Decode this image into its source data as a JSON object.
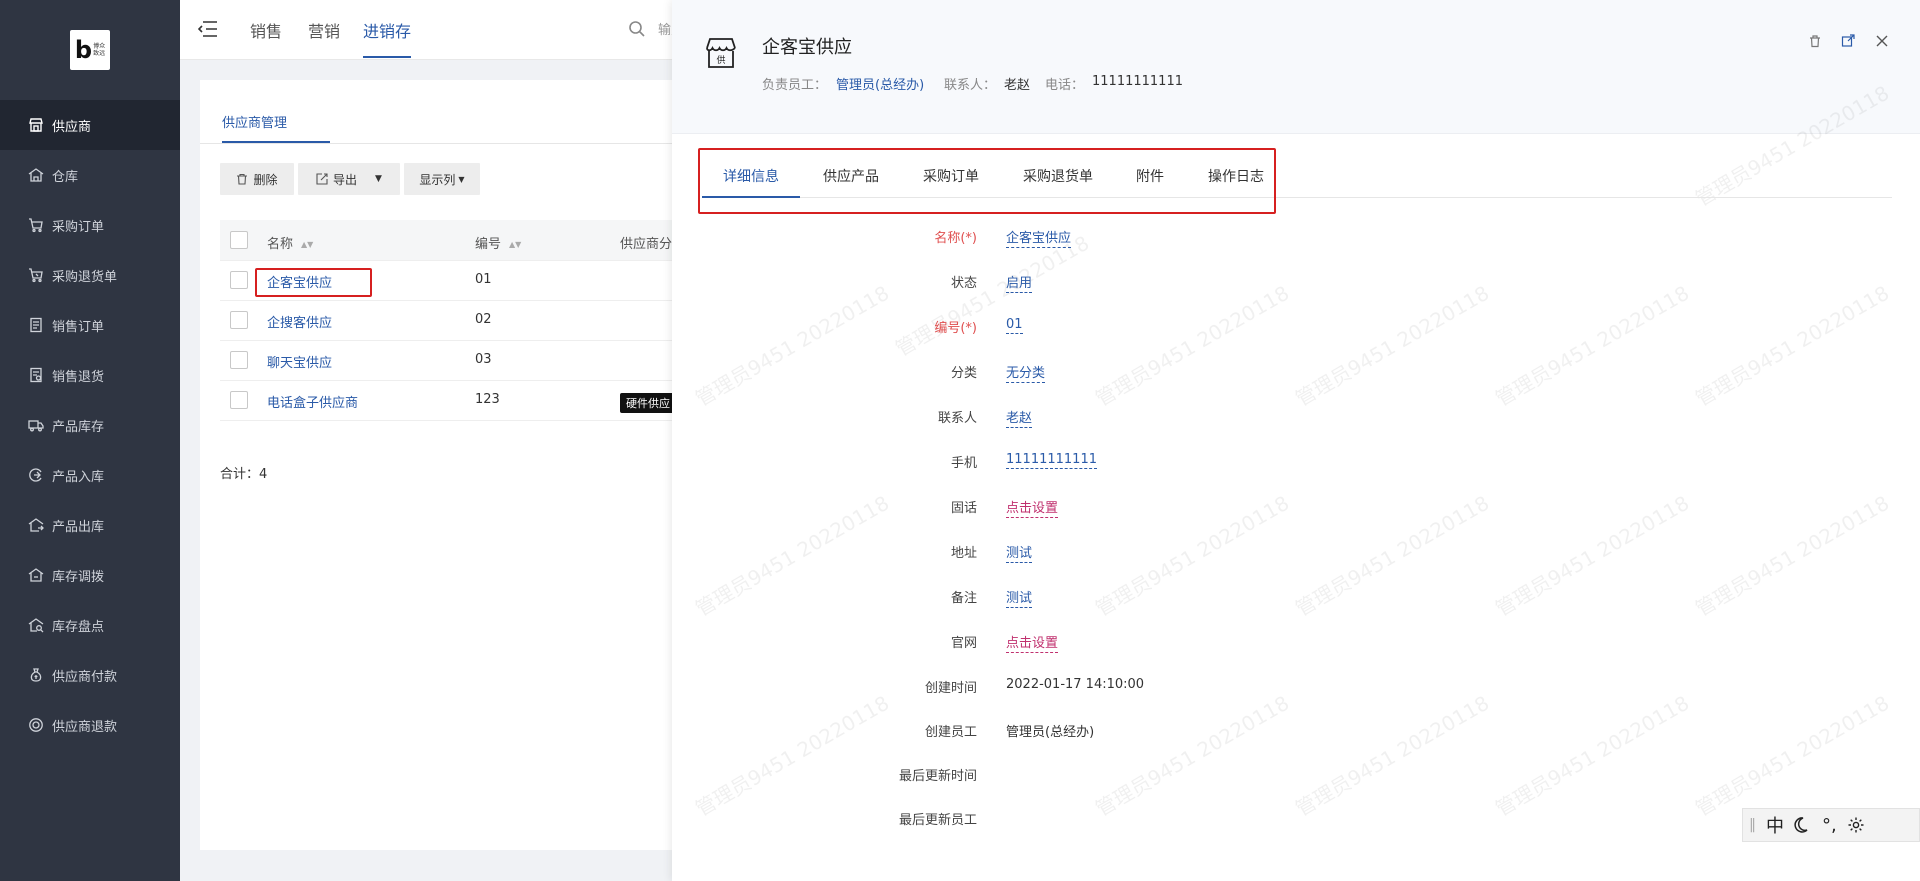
{
  "logo": {
    "mark": "b",
    "text_line1": "博众",
    "text_line2": "致远"
  },
  "sidebar": {
    "items": [
      {
        "label": "供应商",
        "icon": "store-icon"
      },
      {
        "label": "仓库",
        "icon": "warehouse-icon"
      },
      {
        "label": "采购订单",
        "icon": "cart-icon"
      },
      {
        "label": "采购退货单",
        "icon": "cart-return-icon"
      },
      {
        "label": "销售订单",
        "icon": "document-icon"
      },
      {
        "label": "销售退货",
        "icon": "document-return-icon"
      },
      {
        "label": "产品库存",
        "icon": "truck-icon"
      },
      {
        "label": "产品入库",
        "icon": "inbound-icon"
      },
      {
        "label": "产品出库",
        "icon": "outbound-icon"
      },
      {
        "label": "库存调拨",
        "icon": "transfer-icon"
      },
      {
        "label": "库存盘点",
        "icon": "inventory-check-icon"
      },
      {
        "label": "供应商付款",
        "icon": "money-bag-icon"
      },
      {
        "label": "供应商退款",
        "icon": "refund-icon"
      }
    ],
    "active_index": 0
  },
  "topbar": {
    "tabs": [
      "销售",
      "营销",
      "进销存"
    ],
    "active_tab": "进销存",
    "search_placeholder": "输入客户名快速检索..."
  },
  "list": {
    "tab_label": "供应商管理",
    "toolbar": {
      "delete": "删除",
      "export": "导出",
      "columns": "显示列"
    },
    "columns": [
      "名称",
      "编号",
      "供应商分"
    ],
    "rows": [
      {
        "name": "企客宝供应",
        "code": "01",
        "tag": ""
      },
      {
        "name": "企搜客供应",
        "code": "02",
        "tag": ""
      },
      {
        "name": "聊天宝供应",
        "code": "03",
        "tag": ""
      },
      {
        "name": "电话盒子供应商",
        "code": "123",
        "tag": "硬件供应"
      }
    ],
    "total_label": "合计：4"
  },
  "drawer": {
    "title": "企客宝供应",
    "owner_label": "负责员工：",
    "owner_value": "管理员(总经办)",
    "contact_label": "联系人：",
    "contact_value": "老赵",
    "phone_label": "电话：",
    "phone_value": "11111111111",
    "store_icon_char": "供",
    "tabs": [
      "详细信息",
      "供应产品",
      "采购订单",
      "采购退货单",
      "附件",
      "操作日志"
    ],
    "active_tab": "详细信息",
    "fields": [
      {
        "label": "名称(*)",
        "value": "企客宝供应"
      },
      {
        "label": "状态",
        "value": "启用"
      },
      {
        "label": "编号(*)",
        "value": "01"
      },
      {
        "label": "分类",
        "value": "无分类"
      },
      {
        "label": "联系人",
        "value": "老赵"
      },
      {
        "label": "手机",
        "value": "11111111111"
      },
      {
        "label": "固话",
        "value": "点击设置"
      },
      {
        "label": "地址",
        "value": "测试"
      },
      {
        "label": "备注",
        "value": "测试"
      },
      {
        "label": "官网",
        "value": "点击设置"
      },
      {
        "label": "创建时间",
        "value": "2022-01-17 14:10:00"
      },
      {
        "label": "创建员工",
        "value": "管理员(总经办)"
      },
      {
        "label": "最后更新时间",
        "value": ""
      },
      {
        "label": "最后更新员工",
        "value": ""
      }
    ],
    "watermark": "管理员9451 20220118"
  },
  "ime": {
    "mode": "中",
    "symbols": "°,"
  },
  "colors": {
    "accent": "#2a5aa8",
    "sidebar_bg": "#2f3542",
    "highlight_red": "#d62020",
    "required_red": "#e05050",
    "set_link": "#c0306e"
  }
}
